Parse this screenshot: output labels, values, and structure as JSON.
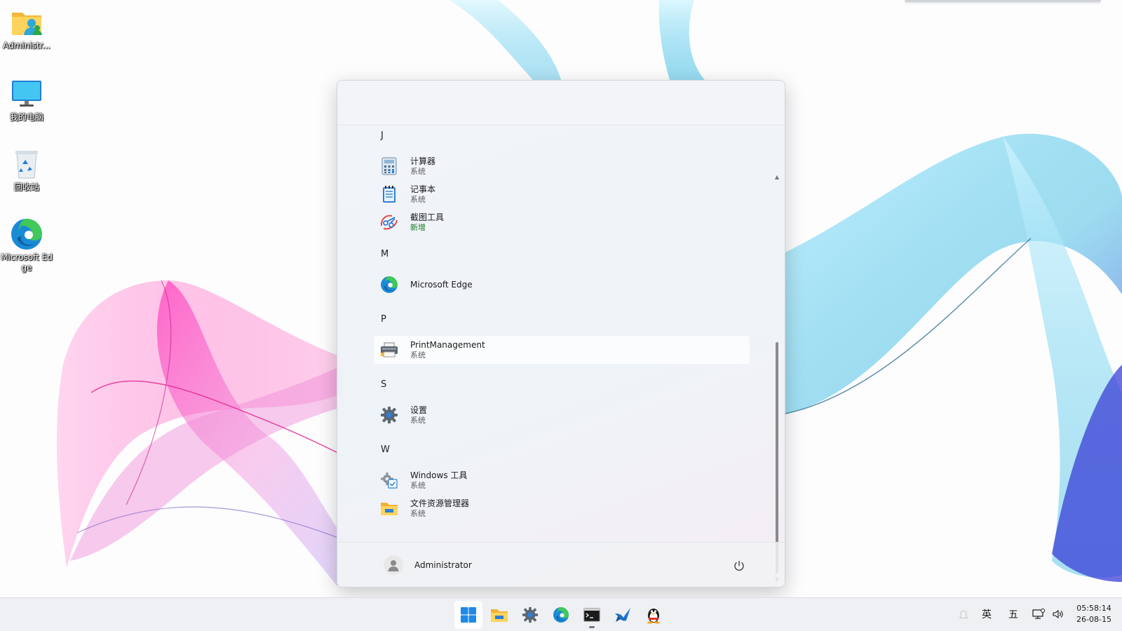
{
  "desktop": {
    "icons": [
      {
        "label": "Administr...",
        "icon": "user-folder-icon"
      },
      {
        "label": "我的电脑",
        "icon": "computer-monitor-icon"
      },
      {
        "label": "回收站",
        "icon": "recycle-bin-icon"
      },
      {
        "label": "Microsoft Edge",
        "icon": "edge-icon"
      }
    ]
  },
  "start_menu": {
    "groups": [
      {
        "letter": "J",
        "apps": [
          {
            "name": "计算器",
            "sub": "系统",
            "icon": "calculator-icon"
          },
          {
            "name": "记事本",
            "sub": "系统",
            "icon": "notepad-icon"
          },
          {
            "name": "截图工具",
            "sub": "新增",
            "icon": "snipping-tool-icon"
          }
        ]
      },
      {
        "letter": "M",
        "apps": [
          {
            "name": "Microsoft Edge",
            "sub": "",
            "icon": "edge-icon"
          }
        ]
      },
      {
        "letter": "P",
        "apps": [
          {
            "name": "PrintManagement",
            "sub": "系统",
            "icon": "printer-icon"
          }
        ]
      },
      {
        "letter": "S",
        "apps": [
          {
            "name": "设置",
            "sub": "系统",
            "icon": "gear-icon"
          }
        ]
      },
      {
        "letter": "W",
        "apps": [
          {
            "name": "Windows 工具",
            "sub": "系统",
            "icon": "windows-tools-icon"
          },
          {
            "name": "文件资源管理器",
            "sub": "系统",
            "icon": "file-explorer-icon"
          }
        ]
      }
    ],
    "user": {
      "name": "Administrator",
      "icon": "user-avatar-icon"
    },
    "power_icon": "power-icon",
    "hovered_app": "PrintManagement"
  },
  "taskbar": {
    "apps": [
      {
        "name": "start",
        "icon": "windows-start-icon",
        "active": true
      },
      {
        "name": "file-explorer",
        "icon": "folder-icon",
        "active": false
      },
      {
        "name": "settings",
        "icon": "gear-icon",
        "active": false
      },
      {
        "name": "edge",
        "icon": "edge-icon",
        "active": false
      },
      {
        "name": "terminal",
        "icon": "terminal-icon",
        "active": false,
        "running": true
      },
      {
        "name": "bird-app",
        "icon": "bird-icon",
        "active": false
      },
      {
        "name": "qq",
        "icon": "penguin-icon",
        "active": false
      }
    ],
    "tray": {
      "ime_lang": "英",
      "ime_mode": "五",
      "network_icon": "network-icon",
      "volume_icon": "volume-icon",
      "notification_icon": "notification-icon"
    },
    "clock": {
      "time": "05:58:14",
      "date": "26-08-15"
    }
  },
  "colors": {
    "accent": "#0067c0",
    "new_badge": "#1c7a2a"
  }
}
